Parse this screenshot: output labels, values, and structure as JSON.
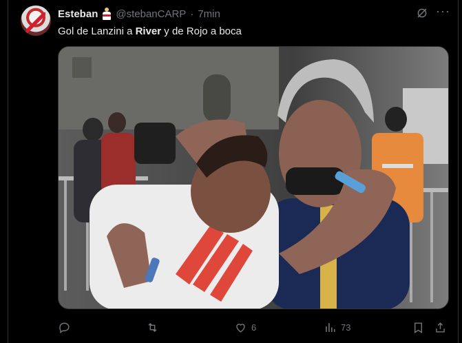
{
  "tweet": {
    "display_name": "Esteban",
    "badge_icon": "river-fan-emoji-icon",
    "handle": "@stebanCARP",
    "separator": "·",
    "time": "7min",
    "text_part1": "Gol de Lanzini a ",
    "text_bold": "River",
    "text_part2": " y de Rojo a boca",
    "photo_alt": "photo"
  },
  "actions": {
    "reply_count": "",
    "retweet_count": "",
    "like_count": "6",
    "views_count": "73"
  },
  "icons": {
    "grok": "grok-icon",
    "more": "more-icon",
    "reply": "reply-icon",
    "retweet": "retweet-icon",
    "like": "heart-icon",
    "views": "views-icon",
    "bookmark": "bookmark-icon",
    "share": "share-icon"
  },
  "colors": {
    "background": "#000000",
    "text": "#e7e9ea",
    "muted": "#71767b",
    "border": "#2f3336"
  }
}
